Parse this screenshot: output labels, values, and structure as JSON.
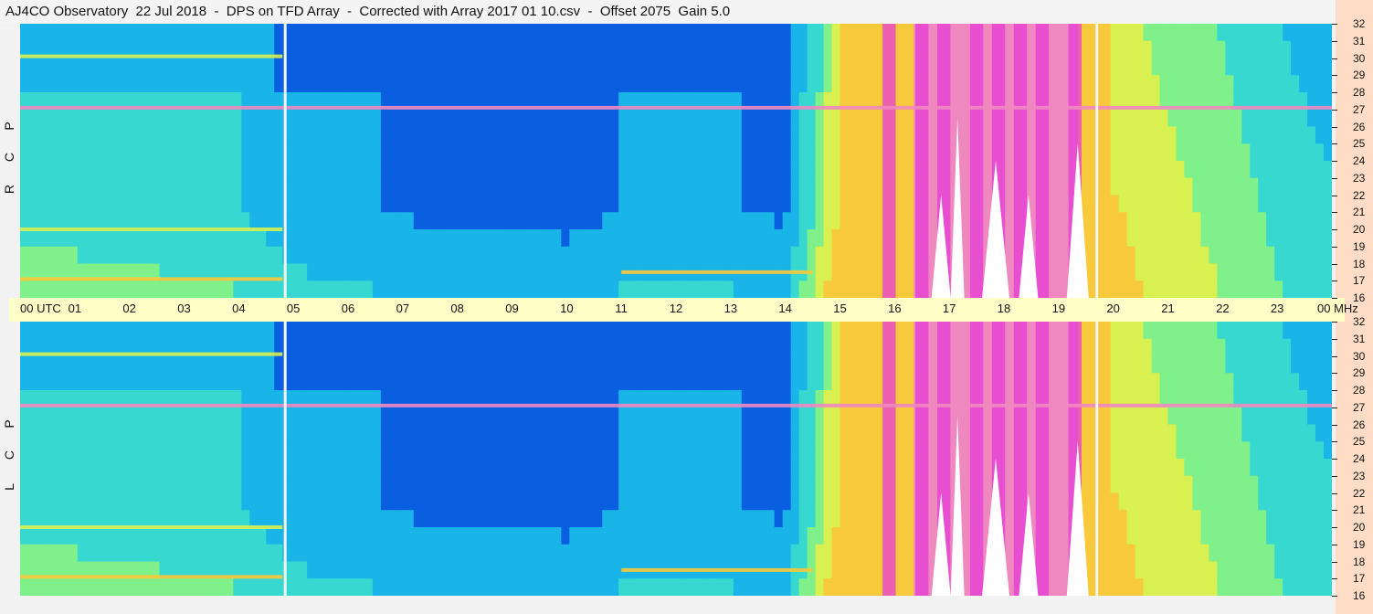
{
  "title": "AJ4CO Observatory  22 Jul 2018  -  DPS on TFD Array  -  Corrected with Array 2017 01 10.csv  -  Offset 2075  Gain 5.0",
  "chart_data": {
    "type": "heatmap",
    "title": "AJ4CO Observatory  22 Jul 2018  -  DPS on TFD Array  -  Corrected with Array 2017 01 10.csv  -  Offset 2075  Gain 5.0",
    "x_axis": {
      "labels": [
        "00",
        "01",
        "02",
        "03",
        "04",
        "05",
        "06",
        "07",
        "08",
        "09",
        "10",
        "11",
        "12",
        "13",
        "14",
        "15",
        "16",
        "17",
        "18",
        "19",
        "20",
        "21",
        "22",
        "23",
        "00"
      ],
      "start_label": "00 UTC",
      "end_label": "00 MHz",
      "unit": "UTC",
      "range": [
        0,
        24
      ]
    },
    "y_axis": {
      "unit": "MHz",
      "range": [
        16,
        32
      ],
      "ticks": [
        32,
        31,
        30,
        29,
        28,
        27,
        26,
        25,
        24,
        23,
        22,
        21,
        20,
        19,
        18,
        17,
        16
      ]
    },
    "panels": [
      {
        "name": "RCP",
        "letters": [
          "P",
          "C",
          "R"
        ]
      },
      {
        "name": "LCP",
        "letters": [
          "P",
          "C",
          "L"
        ]
      }
    ],
    "colormap": [
      "#002a9a",
      "#0a5fe0",
      "#19b4e8",
      "#36d8d0",
      "#7ff08a",
      "#d8f050",
      "#f8c93a",
      "#f088c0",
      "#e63cd6",
      "#ffffff"
    ],
    "background_intensity_by_hour": [
      0.33,
      0.33,
      0.31,
      0.3,
      0.28,
      0.2,
      0.18,
      0.16,
      0.14,
      0.14,
      0.13,
      0.17,
      0.19,
      0.17,
      0.15,
      0.62,
      0.7,
      0.76,
      0.78,
      0.76,
      0.66,
      0.58,
      0.5,
      0.4,
      0.33
    ],
    "vertical_gaps_hour": [
      4.85,
      19.7
    ],
    "bright_column_hours": [
      15.9,
      16.5,
      16.9,
      17.5,
      17.9,
      18.3,
      18.7,
      19.3
    ],
    "interference_lines_mhz": [
      {
        "mhz": 27.1,
        "intensity": 0.74,
        "from_hour": 0.0,
        "to_hour": 24.0
      },
      {
        "mhz": 17.5,
        "intensity": 0.72,
        "from_hour": 11.0,
        "to_hour": 14.5
      },
      {
        "mhz": 17.1,
        "intensity": 0.7,
        "from_hour": 0.0,
        "to_hour": 4.8
      },
      {
        "mhz": 20.0,
        "intensity": 0.6,
        "from_hour": 0.0,
        "to_hour": 4.8
      },
      {
        "mhz": 30.1,
        "intensity": 0.55,
        "from_hour": 0.0,
        "to_hour": 4.8
      }
    ],
    "white_spikes": [
      {
        "hour": 16.85,
        "peak_mhz": 22.0,
        "width_hours": 0.35
      },
      {
        "hour": 17.15,
        "peak_mhz": 26.5,
        "width_hours": 0.25
      },
      {
        "hour": 17.85,
        "peak_mhz": 24.0,
        "width_hours": 0.5
      },
      {
        "hour": 18.45,
        "peak_mhz": 22.0,
        "width_hours": 0.35
      },
      {
        "hour": 19.35,
        "peak_mhz": 25.0,
        "width_hours": 0.4
      }
    ]
  }
}
